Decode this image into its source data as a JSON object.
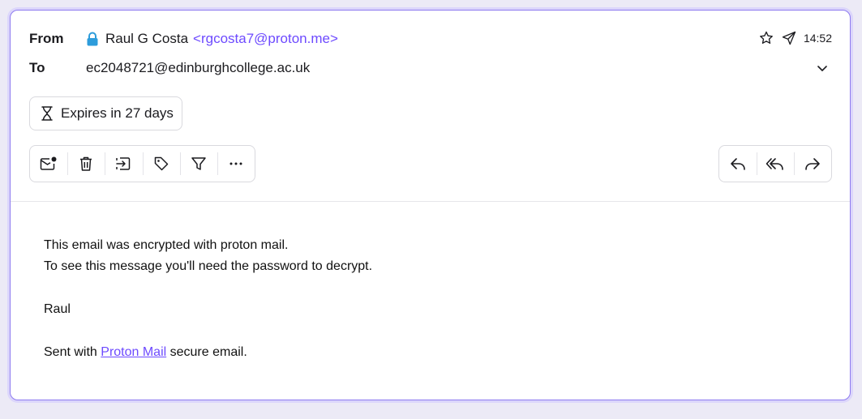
{
  "header": {
    "from_label": "From",
    "to_label": "To",
    "sender_name": "Raul G Costa",
    "sender_address": "<rgcosta7@proton.me>",
    "recipient": "ec2048721@edinburghcollege.ac.uk",
    "time": "14:52",
    "icons": {
      "lock": "lock-icon",
      "star": "star-icon",
      "sent": "paper-plane-icon",
      "expand": "chevron-down-icon"
    }
  },
  "expiration": {
    "label": "Expires in 27 days",
    "icon": "hourglass-icon"
  },
  "toolbar": {
    "left_actions": [
      "mark-unread-icon",
      "trash-icon",
      "move-to-icon",
      "label-icon",
      "filter-icon",
      "more-icon"
    ],
    "right_actions": [
      "reply-icon",
      "reply-all-icon",
      "forward-icon"
    ]
  },
  "message": {
    "line1": "This email was encrypted with proton mail.",
    "line2": "To see this message you'll need the password to decrypt.",
    "signature": "Raul",
    "footer_prefix": "Sent with ",
    "footer_link": "Proton Mail",
    "footer_suffix": " secure email."
  },
  "colors": {
    "accent": "#6d4aff",
    "lock": "#2d9cdb",
    "border_focus": "#8e7bf0"
  }
}
